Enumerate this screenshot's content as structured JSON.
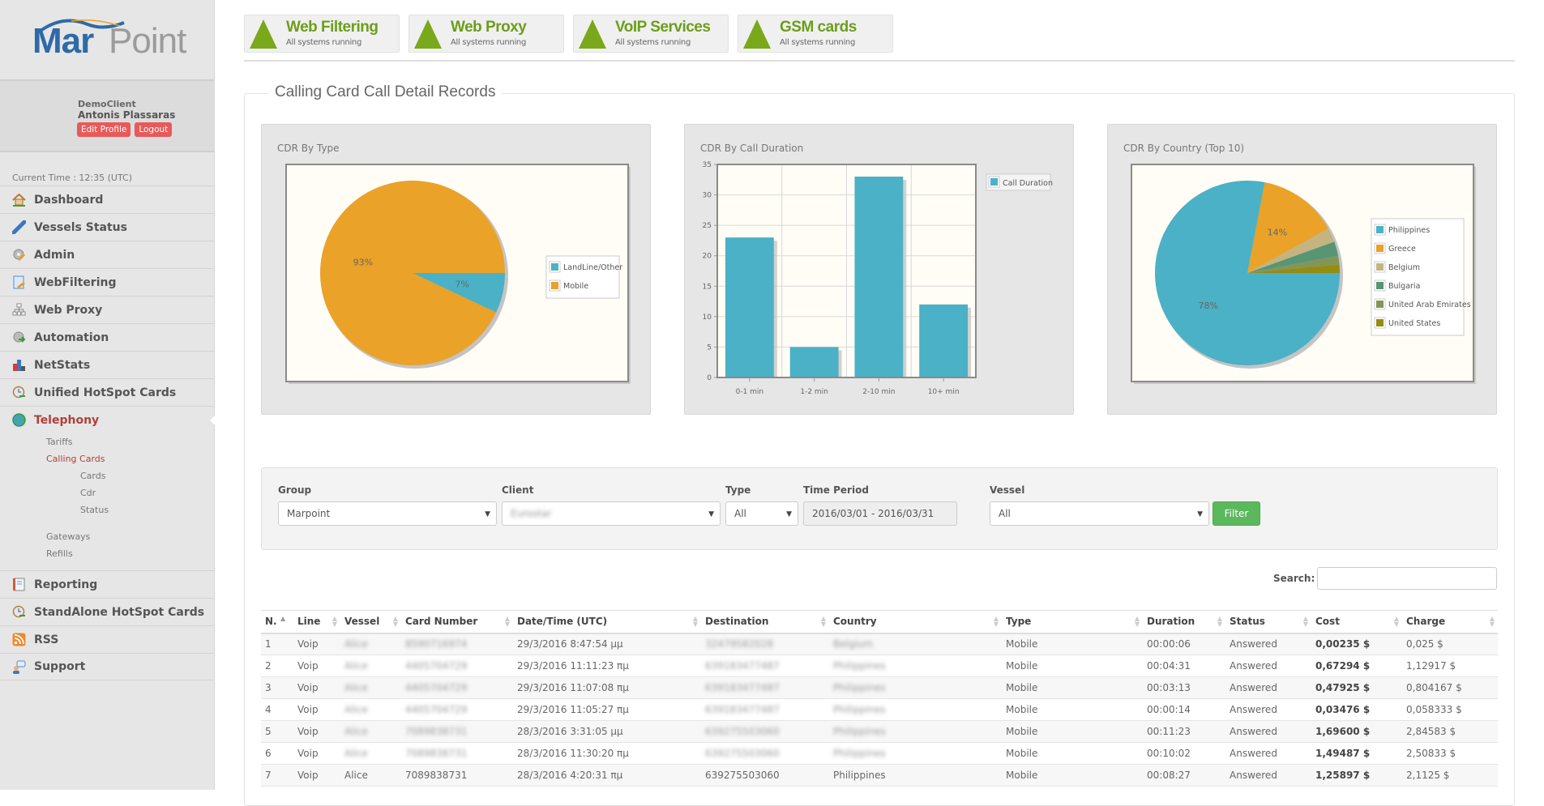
{
  "brand": {
    "part1": "Mar",
    "part2": "Point"
  },
  "user": {
    "client": "DemoClient",
    "name": "Antonis Plassaras",
    "edit_profile": "Edit Profile",
    "logout": "Logout"
  },
  "current_time": "Current Time : 12:35 (UTC)",
  "nav": [
    {
      "label": "Dashboard",
      "icon": "home-icon"
    },
    {
      "label": "Vessels Status",
      "icon": "satellite-icon"
    },
    {
      "label": "Admin",
      "icon": "gear-pencil-icon"
    },
    {
      "label": "WebFiltering",
      "icon": "document-key-icon"
    },
    {
      "label": "Web Proxy",
      "icon": "network-icon"
    },
    {
      "label": "Automation",
      "icon": "gear-arrow-icon"
    },
    {
      "label": "NetStats",
      "icon": "bar-chart-icon"
    },
    {
      "label": "Unified HotSpot Cards",
      "icon": "clock-arrow-icon"
    },
    {
      "label": "Telephony",
      "icon": "globe-icon",
      "active": true
    },
    {
      "label": "Reporting",
      "icon": "notebook-icon"
    },
    {
      "label": "StandAlone HotSpot Cards",
      "icon": "clock-arrow-icon"
    },
    {
      "label": "RSS",
      "icon": "rss-icon"
    },
    {
      "label": "Support",
      "icon": "support-chat-icon"
    }
  ],
  "telephony_sub": {
    "tariffs": "Tariffs",
    "calling_cards": "Calling Cards",
    "cards": "Cards",
    "cdr": "Cdr",
    "status": "Status",
    "gateways": "Gateways",
    "refills": "Refills"
  },
  "status_tiles": [
    {
      "title": "Web Filtering",
      "status": "All systems running"
    },
    {
      "title": "Web Proxy",
      "status": "All systems running"
    },
    {
      "title": "VoIP Services",
      "status": "All systems running"
    },
    {
      "title": "GSM cards",
      "status": "All systems running"
    }
  ],
  "section_title": "Calling Card Call Detail Records",
  "colors": {
    "teal": "#4ab1c6",
    "orange": "#eaa228",
    "green_status": "#7aa81b",
    "accent_red": "#b0403a"
  },
  "chart_data": [
    {
      "type": "pie",
      "title": "CDR By Type",
      "labels": [
        "LandLine/Other",
        "Mobile"
      ],
      "values": [
        7,
        93
      ],
      "colors": [
        "#4ab1c6",
        "#eaa228"
      ],
      "data_labels": [
        "7%",
        "93%"
      ],
      "legend": "right"
    },
    {
      "type": "bar",
      "title": "CDR By Call Duration",
      "categories": [
        "0-1 min",
        "1-2 min",
        "2-10 min",
        "10+ min"
      ],
      "series": [
        {
          "name": "Call Duration",
          "values": [
            23,
            5,
            33,
            12
          ],
          "color": "#4ab1c6"
        }
      ],
      "ylim": [
        0,
        35
      ],
      "yticks": [
        0,
        5,
        10,
        15,
        20,
        25,
        30,
        35
      ],
      "grid": true,
      "legend": "top-right"
    },
    {
      "type": "pie",
      "title": "CDR By Country (Top 10)",
      "labels": [
        "Philippines",
        "Greece",
        "Belgium",
        "Bulgaria",
        "United Arab Emirates",
        "United States"
      ],
      "values": [
        78,
        14,
        2.5,
        2.5,
        1.5,
        1.5
      ],
      "colors": [
        "#4ab1c6",
        "#eaa228",
        "#c5b47f",
        "#579575",
        "#839557",
        "#958c12"
      ],
      "data_labels": [
        "78%",
        "14%",
        "",
        "",
        "",
        ""
      ],
      "legend": "right"
    }
  ],
  "filters": {
    "group": {
      "label": "Group",
      "value": "Marpoint"
    },
    "client": {
      "label": "Client",
      "value": "Eurostar"
    },
    "type": {
      "label": "Type",
      "value": "All"
    },
    "time_period": {
      "label": "Time Period",
      "value": "2016/03/01 - 2016/03/31"
    },
    "vessel": {
      "label": "Vessel",
      "value": "All"
    },
    "filter_button": "Filter"
  },
  "search": {
    "label": "Search:",
    "value": ""
  },
  "table": {
    "columns": [
      "N.",
      "Line",
      "Vessel",
      "Card Number",
      "Date/Time (UTC)",
      "Destination",
      "Country",
      "Type",
      "Duration",
      "Status",
      "Cost",
      "Charge"
    ],
    "rows": [
      [
        "1",
        "Voip",
        "Alice",
        "8590716974",
        "29/3/2016 8:47:54 μμ",
        "32479582028",
        "Belgium",
        "Mobile",
        "00:00:06",
        "Answered",
        "0,00235 $",
        "0,025 $"
      ],
      [
        "2",
        "Voip",
        "Alice",
        "4405704729",
        "29/3/2016 11:11:23 πμ",
        "639183477487",
        "Philippines",
        "Mobile",
        "00:04:31",
        "Answered",
        "0,67294 $",
        "1,12917 $"
      ],
      [
        "3",
        "Voip",
        "Alice",
        "4405704729",
        "29/3/2016 11:07:08 πμ",
        "639183477487",
        "Philippines",
        "Mobile",
        "00:03:13",
        "Answered",
        "0,47925 $",
        "0,804167 $"
      ],
      [
        "4",
        "Voip",
        "Alice",
        "4405704729",
        "29/3/2016 11:05:27 πμ",
        "639183477487",
        "Philippines",
        "Mobile",
        "00:00:14",
        "Answered",
        "0,03476 $",
        "0,058333 $"
      ],
      [
        "5",
        "Voip",
        "Alice",
        "7089838731",
        "28/3/2016 3:31:05 μμ",
        "639275503060",
        "Philippines",
        "Mobile",
        "00:11:23",
        "Answered",
        "1,69600 $",
        "2,84583 $"
      ],
      [
        "6",
        "Voip",
        "Alice",
        "7089838731",
        "28/3/2016 11:30:20 πμ",
        "639275503060",
        "Philippines",
        "Mobile",
        "00:10:02",
        "Answered",
        "1,49487 $",
        "2,50833 $"
      ],
      [
        "7",
        "Voip",
        "Alice",
        "7089838731",
        "28/3/2016 4:20:31 πμ",
        "639275503060",
        "Philippines",
        "Mobile",
        "00:08:27",
        "Answered",
        "1,25897 $",
        "2,1125 $"
      ]
    ],
    "blurred_rows": [
      0,
      1,
      2,
      3,
      4,
      5
    ]
  }
}
